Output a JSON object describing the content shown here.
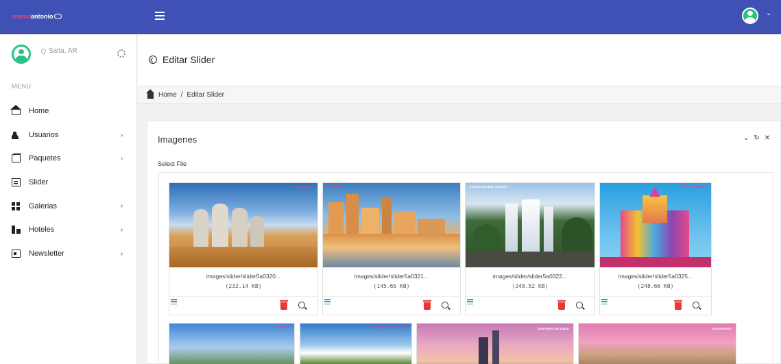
{
  "topbar": {
    "brand_part1": "marco",
    "brand_part2": "antonio",
    "menu_icon": "hamburger-icon",
    "user_icon": "user-avatar-icon",
    "caret": "⌄"
  },
  "sidebar": {
    "location": "Salta, AR",
    "menu_title": "MENU",
    "items": [
      {
        "label": "Home",
        "icon": "home-icon"
      },
      {
        "label": "Usuarios",
        "icon": "users-icon",
        "chevron": "›"
      },
      {
        "label": "Paquetes",
        "icon": "package-icon",
        "chevron": "›"
      },
      {
        "label": "Slider",
        "icon": "slider-icon"
      },
      {
        "label": "Galerias",
        "icon": "gallery-icon",
        "chevron": "›"
      },
      {
        "label": "Hoteles",
        "icon": "hotel-icon",
        "chevron": "›"
      },
      {
        "label": "Newsletter",
        "icon": "newsletter-icon",
        "chevron": "›"
      }
    ]
  },
  "header": {
    "title": "Editar Slider"
  },
  "breadcrumb": {
    "home": "Home",
    "separator": "/",
    "current": "Editar Slider"
  },
  "panel": {
    "title": "Imagenes",
    "tools": {
      "collapse": "⌄",
      "refresh": "↻",
      "close": "✕"
    },
    "select_file": "Select File",
    "images": [
      {
        "name": "images/slider/slider5a0320...",
        "size": "(232.14 KB)",
        "watermark": "marcoantonio"
      },
      {
        "name": "images/slider/slider5a0321...",
        "size": "(145.65 KB)",
        "watermark": "CAMBORIÚ"
      },
      {
        "name": "images/slider/slider5a0322...",
        "size": "(248.52 KB)",
        "watermark": "CATARATAS DEL IGUAZÚ"
      },
      {
        "name": "images/slider/slider5a0325...",
        "size": "(248.66 KB)",
        "watermark": "BETO CARRERO"
      }
    ],
    "row2_captions": [
      "ITAPEMA",
      "RUINAS DE SAN IGNACIO",
      "SANTIAGO DE CHILE",
      "VALPARAÍSO"
    ]
  }
}
